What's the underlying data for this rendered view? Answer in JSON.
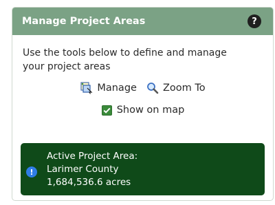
{
  "panel": {
    "title": "Manage Project Areas",
    "help_label": "?"
  },
  "description": "Use the tools below to define and manage your project areas",
  "tools": {
    "manage_label": "Manage",
    "manage_icon": "manage-areas-icon",
    "zoom_label": "Zoom To",
    "zoom_icon": "magnifier-icon"
  },
  "show_on_map": {
    "label": "Show on map",
    "checked": true
  },
  "active_area": {
    "heading": "Active Project Area:",
    "name": "Larimer County",
    "area": "1,684,536.6 acres",
    "icon": "info-icon",
    "icon_glyph": "!"
  },
  "colors": {
    "header": "#7ba285",
    "alert_bg": "#0f4a19",
    "alert_icon": "#2f7de6",
    "checkbox": "#3a8a3a"
  }
}
